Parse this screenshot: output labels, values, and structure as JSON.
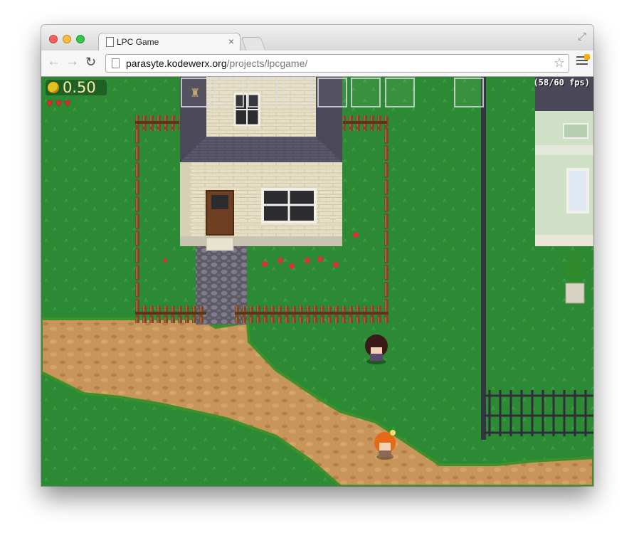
{
  "browser": {
    "tab_title": "LPC Game",
    "tab_close": "×",
    "url_host": "parasyte.kodewerx.org",
    "url_path": "/projects/lpcgame/",
    "back_icon": "arrow-left",
    "forward_icon": "arrow-right",
    "reload_icon": "reload",
    "star_icon": "star",
    "menu_icon": "hamburger-menu"
  },
  "hud": {
    "coins": "0.50",
    "hearts": 3,
    "fps": "(58/60 fps)",
    "inventory_slots": 8,
    "inventory_items": [
      "bag",
      "",
      "",
      "",
      "",
      "",
      "",
      ""
    ]
  },
  "colors": {
    "grass": "#2d8a34",
    "path": "#c6945a",
    "house_wall": "#e6dfc6",
    "roof": "#5a586a",
    "fence": "#7a4a2a"
  }
}
